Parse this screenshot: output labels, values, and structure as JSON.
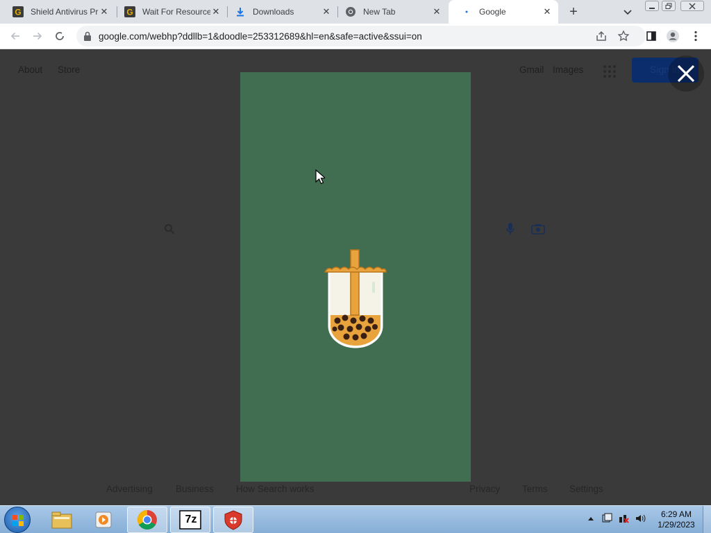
{
  "tabs": [
    {
      "title": "Shield Antivirus Pr",
      "icon": "g-icon",
      "active": false
    },
    {
      "title": "Wait For Resource",
      "icon": "g-icon",
      "active": false
    },
    {
      "title": "Downloads",
      "icon": "download-icon",
      "active": false
    },
    {
      "title": "New Tab",
      "icon": "chrome-icon",
      "active": false
    },
    {
      "title": "Google",
      "icon": "loading-icon",
      "active": true
    }
  ],
  "tab_close_glyph": "✕",
  "new_tab_glyph": "+",
  "address_bar": {
    "url": "google.com/webhp?ddllb=1&doodle=253312689&hl=en&safe=active&ssui=on"
  },
  "page": {
    "header_left": [
      "About",
      "Store"
    ],
    "header_right": [
      "Gmail",
      "Images"
    ],
    "sign_in_label": "Sign in",
    "footer_left": [
      "Advertising",
      "Business",
      "How Search works"
    ],
    "footer_right": [
      "Privacy",
      "Terms",
      "Settings"
    ]
  },
  "doodle": {
    "background_color": "#416d51",
    "subject": "bubble tea cup"
  },
  "taskbar": {
    "apps": [
      "file-explorer-icon",
      "media-player-icon",
      "chrome-icon",
      "7zip-icon",
      "shield-antivirus-icon"
    ],
    "seven_zip_label": "7z",
    "clock_time": "6:29 AM",
    "clock_date": "1/29/2023"
  },
  "colors": {
    "tabstrip": "#dee1e6",
    "page_overlay": "#3a3a3a",
    "taskbar": "#9bbde0"
  }
}
